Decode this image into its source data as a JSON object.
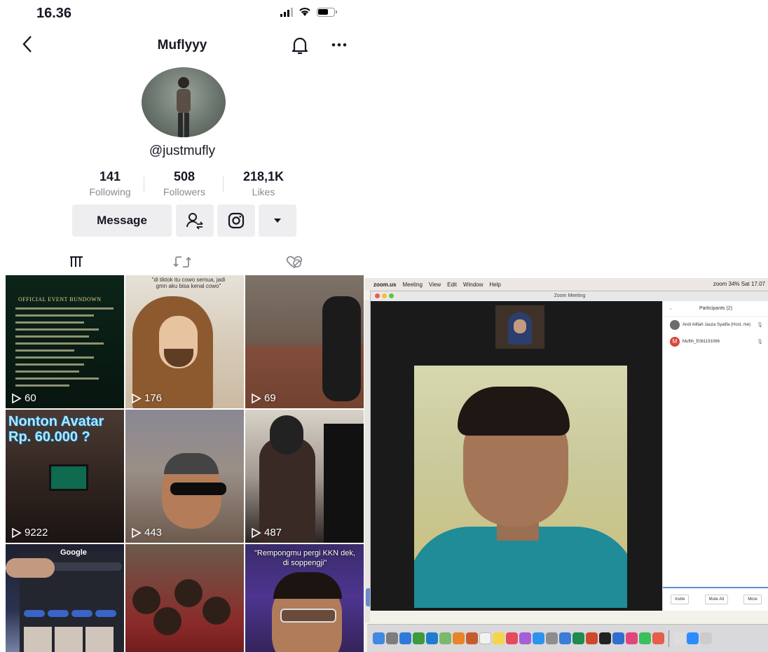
{
  "status": {
    "time": "16.36"
  },
  "profile": {
    "title": "Muflyyy",
    "handle": "@justmufly",
    "stats": [
      {
        "value": "141",
        "label": "Following"
      },
      {
        "value": "508",
        "label": "Followers"
      },
      {
        "value": "218,1K",
        "label": "Likes"
      }
    ],
    "message_label": "Message"
  },
  "icons": {
    "back": "chevron-left-icon",
    "bell": "bell-icon",
    "more": "more-icon",
    "follow": "person-switch-icon",
    "instagram": "instagram-icon",
    "dropdown": "caret-down-icon",
    "videos_tab": "grid-icon",
    "reposts_tab": "repost-icon",
    "liked_tab": "heart-hidden-icon",
    "play": "play-icon"
  },
  "videos": [
    {
      "views": "60",
      "caption": "OFFICIAL EVENT BUNDOWN"
    },
    {
      "views": "176",
      "caption": "\"di tiktok itu cowo semua, jadi gmn aku bisa kenal cowo\""
    },
    {
      "views": "69",
      "caption": ""
    },
    {
      "views": "9222",
      "caption": "Nonton Avatar Rp. 60.000 ?"
    },
    {
      "views": "443",
      "caption": ""
    },
    {
      "views": "487",
      "caption": ""
    },
    {
      "views": "",
      "caption": "Google"
    },
    {
      "views": "",
      "caption": ""
    },
    {
      "views": "",
      "caption": "\"Rempongmu pergi KKN dek, di soppengji\""
    }
  ],
  "mac": {
    "menu": [
      "zoom.us",
      "Meeting",
      "View",
      "Edit",
      "Window",
      "Help"
    ],
    "status_right": "zoom  34%  Sat 17.07",
    "window_title": "Zoom Meeting",
    "participants_title": "Participants (2)",
    "participants": [
      {
        "name": "Andi Alifiah Jauza Syatifa (Host, me)",
        "initial": "",
        "color": "#6b6b6b"
      },
      {
        "name": "Muflih_E061191066",
        "initial": "M",
        "color": "#d9453d"
      }
    ],
    "footer": [
      "Invite",
      "Mute All",
      "More"
    ]
  },
  "colors": {
    "tiktok_text": "#161823",
    "muted": "#8a8b91",
    "button_bg": "#eeeef0",
    "zoom_blue": "#5b8dd6"
  }
}
